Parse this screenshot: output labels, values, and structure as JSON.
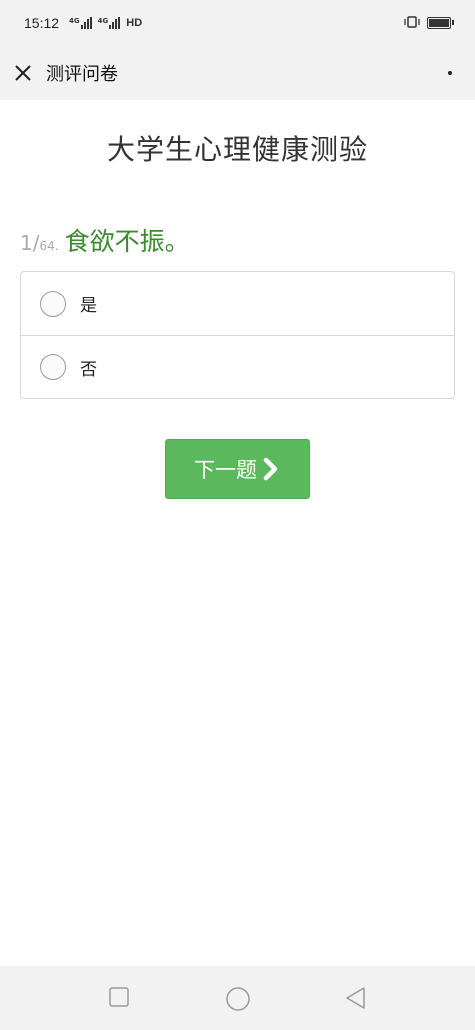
{
  "status_bar": {
    "time": "15:12",
    "signal_1_label": "4G",
    "signal_2_label": "4G",
    "hd_label": "HD"
  },
  "nav": {
    "title": "测评问卷",
    "close_icon": "close-icon",
    "more_icon": "more-icon"
  },
  "survey": {
    "title": "大学生心理健康测验"
  },
  "question": {
    "number": "1",
    "slash": "/",
    "total": "64.",
    "text": "食欲不振。"
  },
  "options": [
    {
      "label": "是",
      "selected": false
    },
    {
      "label": "否",
      "selected": false
    }
  ],
  "next_button": {
    "label": "下一题",
    "icon": "chevron-right-icon"
  },
  "colors": {
    "accent_green": "#5cb85c",
    "question_green": "#3a8a2e",
    "bar_bg": "#f2f2f2"
  },
  "system_nav": {
    "icons": [
      "recent-apps-icon",
      "home-icon",
      "back-icon"
    ]
  }
}
